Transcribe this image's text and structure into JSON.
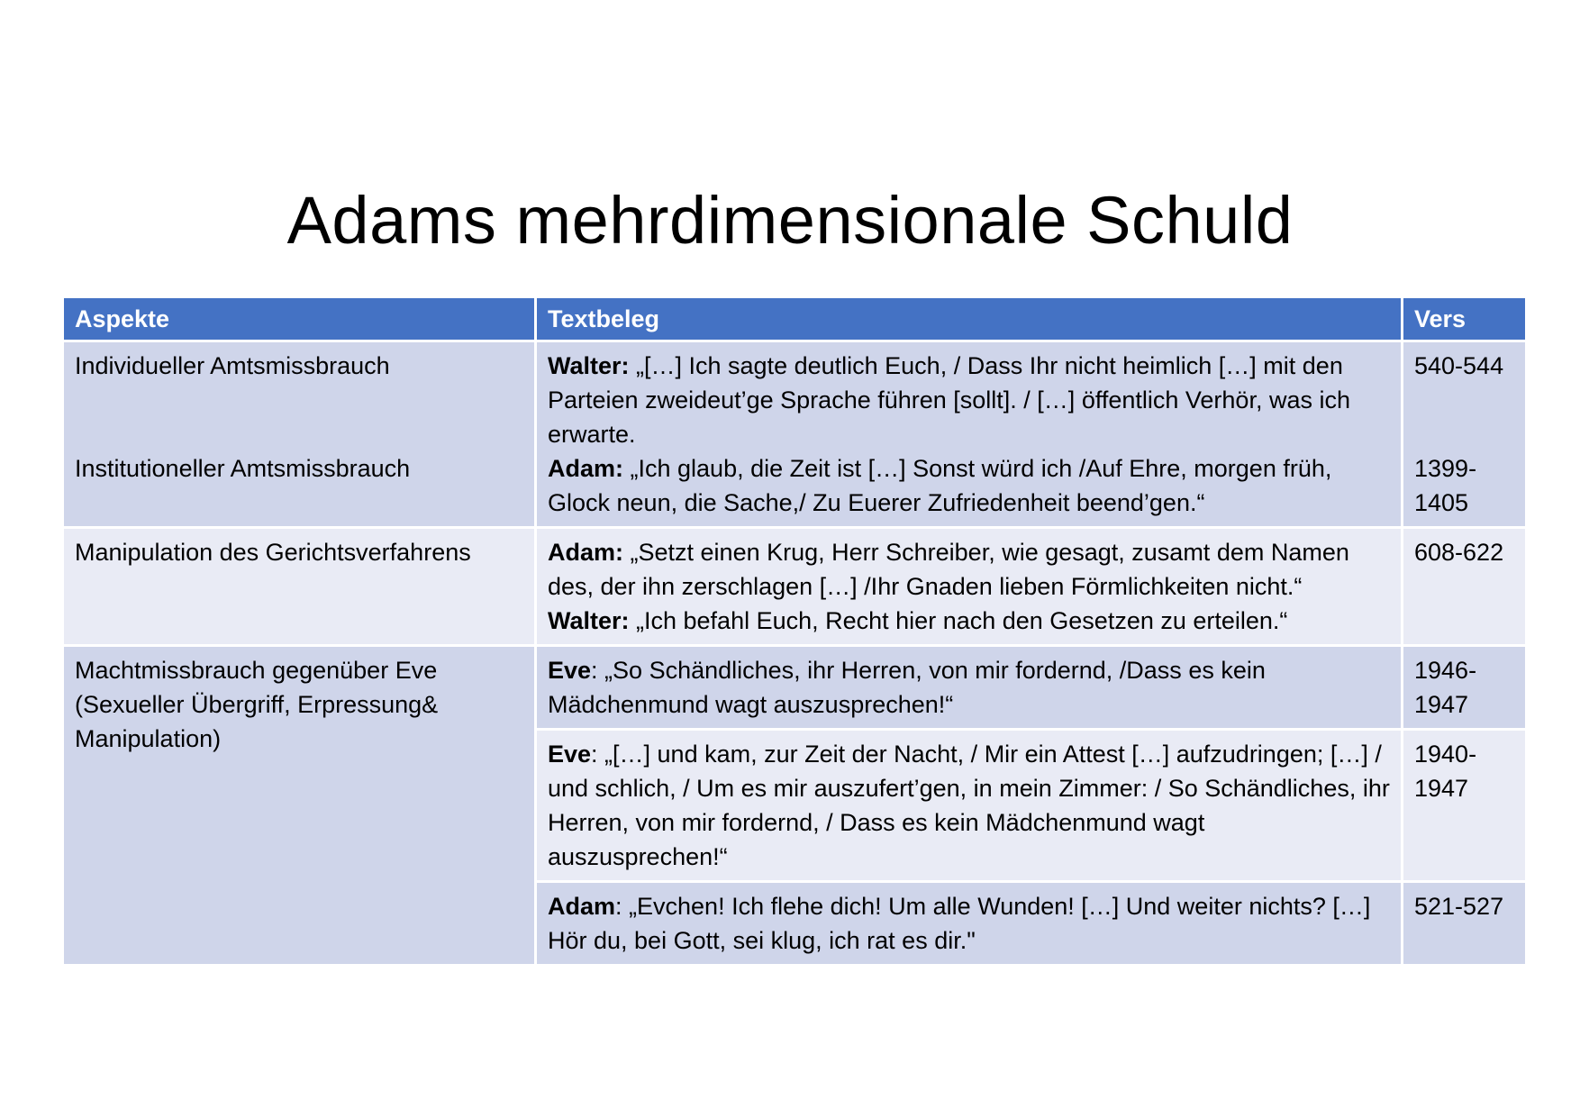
{
  "title": "Adams mehrdimensionale Schuld",
  "table": {
    "headers": [
      "Aspekte",
      "Textbeleg",
      "Vers"
    ],
    "rows": [
      {
        "aspect_1": "Individueller Amtsmissbrauch",
        "aspect_2": "Institutioneller Amtsmissbrauch",
        "evidence_1_speaker": "Walter:",
        "evidence_1_text": " „[…] Ich sagte deutlich Euch, / Dass Ihr nicht heimlich […] mit den Parteien zweideut’ge Sprache führen [sollt]. / […] öffentlich Verhör, was ich erwarte.",
        "evidence_2_speaker": "Adam:",
        "evidence_2_text": " „Ich glaub, die Zeit ist […] Sonst würd ich /Auf Ehre, morgen früh, Glock neun, die Sache,/ Zu Euerer Zufriedenheit beend’gen.“",
        "verse_1": "540-544",
        "verse_2a": "1399-",
        "verse_2b": "1405"
      },
      {
        "aspect": "Manipulation des Gerichtsverfahrens",
        "evidence_1_speaker": "Adam:",
        "evidence_1_text": " „Setzt einen Krug, Herr Schreiber, wie gesagt, zusamt dem Namen des, der ihn zerschlagen […] /Ihr Gnaden lieben Förmlichkeiten nicht.“",
        "evidence_2_speaker": "Walter:",
        "evidence_2_text": " „Ich befahl Euch, Recht hier nach den Gesetzen zu erteilen.“",
        "verse": "608-622"
      },
      {
        "aspect": "Machtmissbrauch gegenüber Eve (Sexueller Übergriff, Erpressung& Manipulation)",
        "sub": [
          {
            "speaker": "Eve",
            "text": ": „So Schändliches, ihr Herren, von mir fordernd, /Dass es kein Mädchenmund wagt auszusprechen!“",
            "verse_a": "1946-",
            "verse_b": "1947"
          },
          {
            "speaker": "Eve",
            "text": ": „[…] und kam, zur Zeit der Nacht, / Mir ein Attest […] aufzudringen; […] / und schlich, / Um es mir auszufert’gen, in mein Zimmer: / So Schändliches, ihr Herren, von mir fordernd, / Dass es kein Mädchenmund wagt auszusprechen!“",
            "verse_a": "1940-",
            "verse_b": "1947"
          },
          {
            "speaker": "Adam",
            "text": ": „Evchen! Ich flehe dich! Um alle Wunden! […] Und weiter nichts? […] Hör du, bei Gott, sei klug, ich rat es dir.\"",
            "verse": "521-527"
          }
        ]
      }
    ]
  }
}
